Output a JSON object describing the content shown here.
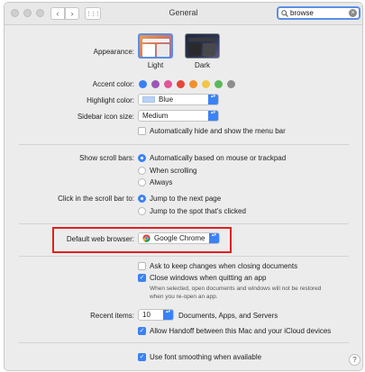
{
  "window": {
    "title": "General"
  },
  "search": {
    "value": "browse",
    "clear_glyph": "×"
  },
  "nav": {
    "back_glyph": "‹",
    "forward_glyph": "›",
    "grid_glyph": "⋮⋮⋮"
  },
  "appearance": {
    "label": "Appearance:",
    "options": [
      {
        "name": "Light",
        "selected": true
      },
      {
        "name": "Dark",
        "selected": false
      }
    ]
  },
  "accent": {
    "label": "Accent color:",
    "colors": [
      "#3a7ff6",
      "#9b59b6",
      "#e0559b",
      "#e5463a",
      "#f0912e",
      "#f3c64a",
      "#5cb85c",
      "#8e8e8e"
    ]
  },
  "highlight_color": {
    "label": "Highlight color:",
    "value": "Blue",
    "swatch": "#b8d3f7"
  },
  "sidebar_icon_size": {
    "label": "Sidebar icon size:",
    "value": "Medium"
  },
  "menu_bar": {
    "label": "Automatically hide and show the menu bar",
    "checked": false
  },
  "scroll_bars": {
    "label": "Show scroll bars:",
    "options": [
      "Automatically based on mouse or trackpad",
      "When scrolling",
      "Always"
    ],
    "selected_index": 0
  },
  "click_scroll": {
    "label": "Click in the scroll bar to:",
    "options": [
      "Jump to the next page",
      "Jump to the spot that's clicked"
    ],
    "selected_index": 0
  },
  "default_browser": {
    "label": "Default web browser:",
    "value": "Google Chrome"
  },
  "documents": {
    "ask_keep": {
      "label": "Ask to keep changes when closing documents",
      "checked": false
    },
    "close_windows": {
      "label": "Close windows when quitting an app",
      "checked": true
    },
    "note": "When selected, open documents and windows will not be restored when you re-open an app."
  },
  "recent_items": {
    "label": "Recent items:",
    "value": "10",
    "suffix": "Documents, Apps, and Servers"
  },
  "handoff": {
    "label": "Allow Handoff between this Mac and your iCloud devices",
    "checked": true
  },
  "font_smoothing": {
    "label": "Use font smoothing when available",
    "checked": true
  },
  "help": {
    "glyph": "?"
  },
  "checkmark": "✓",
  "popup_arrows": "▴▾"
}
